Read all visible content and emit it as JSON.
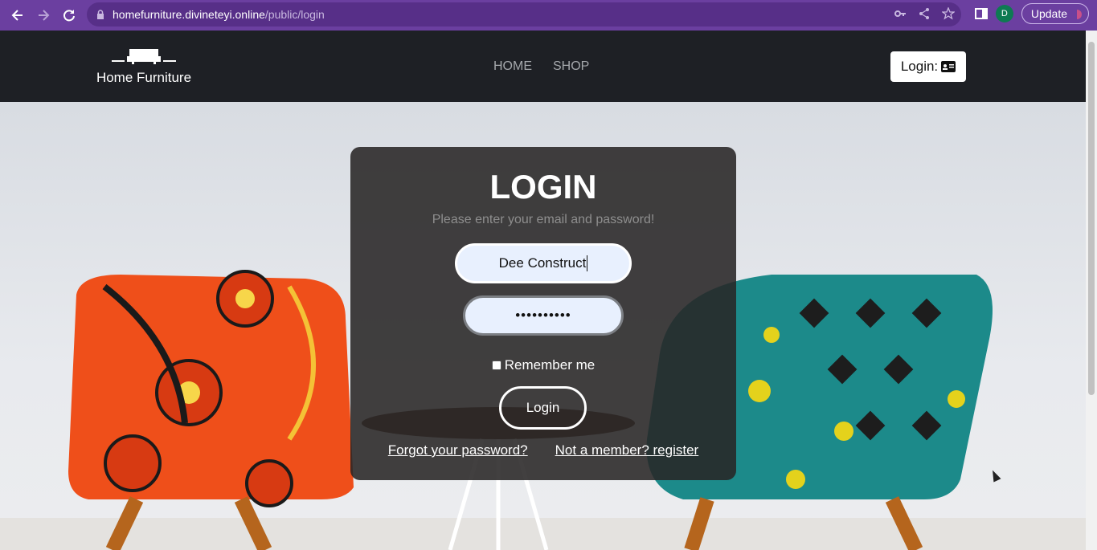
{
  "browser": {
    "url_host": "homefurniture.divineteyi.online",
    "url_path": "/public/login",
    "profile_initial": "D",
    "update_label": "Update"
  },
  "site": {
    "brand": "Home Furniture",
    "nav": [
      "HOME",
      "SHOP"
    ],
    "login_label": "Login:"
  },
  "login": {
    "title": "LOGIN",
    "subtitle": "Please enter your email and password!",
    "username_value": "Dee Construct",
    "password_value": "••••••••••",
    "remember_label": "Remember me",
    "submit_label": "Login",
    "forgot_label": "Forgot your password?",
    "register_label": "Not a member? register"
  },
  "colors": {
    "chrome": "#6b3fa0",
    "header": "#1e2025"
  }
}
